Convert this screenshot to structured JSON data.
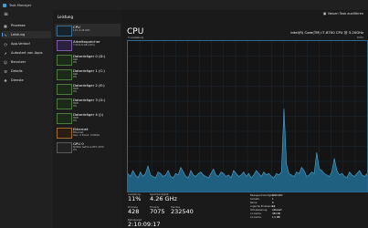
{
  "titlebar": {
    "title": "Task-Manager"
  },
  "nav": {
    "items": [
      {
        "label": "Prozesse",
        "icon": "grid-icon"
      },
      {
        "label": "Leistung",
        "icon": "pulse-icon"
      },
      {
        "label": "App-Verlauf",
        "icon": "history-icon"
      },
      {
        "label": "Autostart von Apps",
        "icon": "rocket-icon"
      },
      {
        "label": "Benutzer",
        "icon": "users-icon"
      },
      {
        "label": "Details",
        "icon": "list-icon"
      },
      {
        "label": "Dienste",
        "icon": "puzzle-icon"
      }
    ]
  },
  "list": {
    "title": "Leistung",
    "resources": [
      {
        "name": "CPU",
        "sub1": "11% 4,26 GHz",
        "sub2": ""
      },
      {
        "name": "Arbeitsspeicher",
        "sub1": "7,5/31,8 GB (24%)",
        "sub2": ""
      },
      {
        "name": "Datenträger 0 (D:)",
        "sub1": "SSD",
        "sub2": "0%"
      },
      {
        "name": "Datenträger 1 (C:)",
        "sub1": "SSD",
        "sub2": "0%"
      },
      {
        "name": "Datenträger 2 (E:)",
        "sub1": "HDD",
        "sub2": "0%"
      },
      {
        "name": "Datenträger 3 (G:)",
        "sub1": "HDD",
        "sub2": "0%"
      },
      {
        "name": "Datenträger 4 (J:)",
        "sub1": "HDD",
        "sub2": "0%"
      },
      {
        "name": "Ethernet",
        "sub1": "Ethernet",
        "sub2": "Ges.: 0 Empf.: 0 KBit/s"
      },
      {
        "name": "GPU 0",
        "sub1": "NVIDIA GeForce RTX 2070",
        "sub2": "0%"
      }
    ]
  },
  "main": {
    "run_task": "Neuen Task ausführen",
    "title": "CPU",
    "model": "Intel(R) Core(TM) i7-8700 CPU @ 3.20GHz",
    "util_label": "% Auslastung",
    "util_max": "100%",
    "stats": {
      "util_label": "Auslastung",
      "util_value": "11%",
      "speed_label": "Geschwindigkeit",
      "speed_value": "4.26 GHz",
      "proc_label": "Prozesse",
      "proc_value": "428",
      "threads_label": "Threads",
      "threads_value": "7075",
      "handles_label": "Handles",
      "handles_value": "232540",
      "uptime_label": "Betriebszeit",
      "uptime_value": "2:10:09:17"
    },
    "details": [
      {
        "label": "Basisgeschwindigkeit:",
        "value": "3,19 GHz"
      },
      {
        "label": "Sockets:",
        "value": "1"
      },
      {
        "label": "Kerne:",
        "value": "6"
      },
      {
        "label": "Logische Prozessoren:",
        "value": "12"
      },
      {
        "label": "Virtualisierung:",
        "value": "Aktiviert"
      },
      {
        "label": "L1-Cache:",
        "value": "384 KB"
      },
      {
        "label": "L2-Cache:",
        "value": "1,5 MB"
      }
    ]
  },
  "chart_data": {
    "type": "area",
    "ylim": [
      0,
      100
    ],
    "values": [
      12,
      10,
      14,
      11,
      9,
      13,
      10,
      12,
      17,
      11,
      10,
      9,
      13,
      12,
      10,
      11,
      14,
      10,
      9,
      12,
      11,
      16,
      13,
      10,
      9,
      14,
      11,
      10,
      12,
      13,
      11,
      10,
      9,
      12,
      15,
      11,
      10,
      13,
      12,
      10,
      11,
      9,
      14,
      12,
      10,
      11,
      13,
      10,
      12,
      9,
      11,
      14,
      12,
      10,
      13,
      11,
      12,
      10,
      9,
      12,
      11,
      13,
      55,
      18,
      12,
      11,
      10,
      13,
      12,
      16,
      14,
      10,
      11,
      13,
      12,
      26,
      15,
      14,
      12,
      11,
      10,
      13,
      22,
      14,
      11,
      12,
      10,
      9,
      13,
      11,
      10,
      12,
      14,
      11,
      10,
      12
    ]
  }
}
